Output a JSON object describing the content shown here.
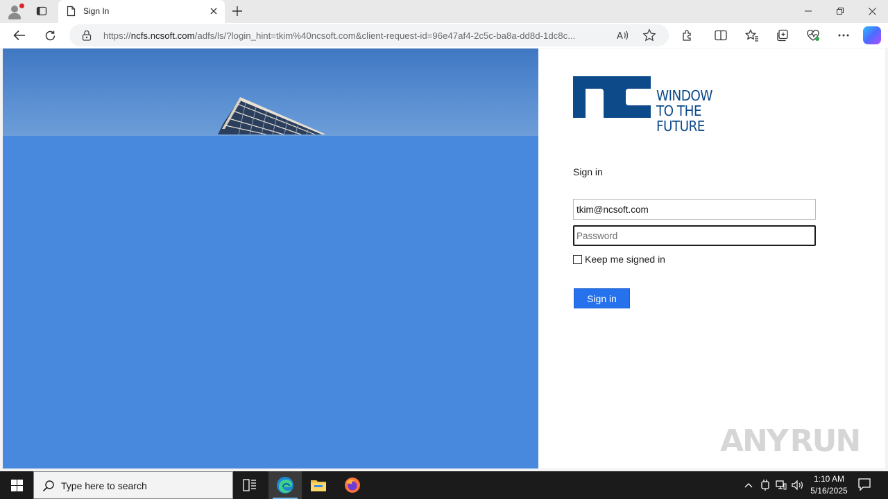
{
  "browser": {
    "tab_title": "Sign In",
    "url_prefix": "https://",
    "url_host": "ncfs.ncsoft.com",
    "url_rest": "/adfs/ls/?login_hint=tkim%40ncsoft.com&client-request-id=96e47af4-2c5c-ba8a-dd8d-1dc8c..."
  },
  "login": {
    "logo_tagline_line1": "WINDOW",
    "logo_tagline_line2": "TO THE FUTURE",
    "title": "Sign in",
    "email_value": "tkim@ncsoft.com",
    "password_placeholder": "Password",
    "keep_signed_in_label": "Keep me signed in",
    "keep_signed_in_checked": false,
    "submit_label": "Sign in",
    "brand_color": "#0c4a8a",
    "button_color": "#2672ec",
    "illustration_color": "#4889de"
  },
  "watermark": {
    "text_left": "ANY",
    "text_right": "RUN"
  },
  "taskbar": {
    "search_placeholder": "Type here to search",
    "time": "1:10 AM",
    "date": "5/16/2025",
    "apps": [
      "task-view-icon",
      "edge-icon",
      "file-explorer-icon",
      "firefox-icon"
    ]
  }
}
